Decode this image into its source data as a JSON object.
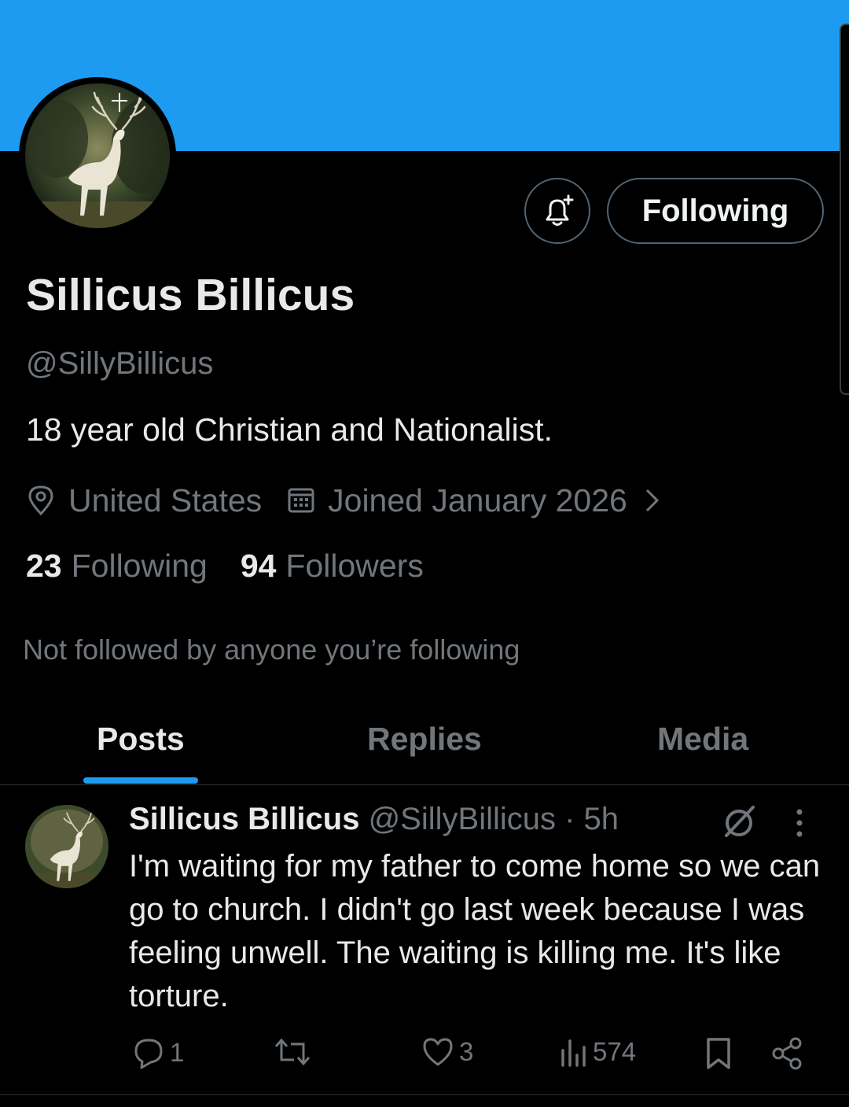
{
  "profile": {
    "name": "Sillicus Billicus",
    "handle": "@SillyBillicus",
    "bio": "18 year old Christian and Nationalist.",
    "location": "United States",
    "joined": "Joined January 2026",
    "following_count": "23",
    "following_label": "Following",
    "followers_count": "94",
    "followers_label": "Followers",
    "not_followed": "Not followed by anyone you’re following",
    "follow_button": "Following"
  },
  "tabs": [
    {
      "label": "Posts",
      "active": true
    },
    {
      "label": "Replies",
      "active": false
    },
    {
      "label": "Media",
      "active": false
    }
  ],
  "post": {
    "author": "Sillicus Billicus",
    "handle": "@SillyBillicus",
    "time": " · 5h",
    "text": "I'm waiting for my father to come home so we can go to church. I didn't go last week because I was feeling unwell. The waiting is killing me. It's like torture.",
    "replies": "1",
    "reposts": "",
    "likes": "3",
    "views": "574"
  },
  "colors": {
    "banner": "#1d9bf0",
    "accent": "#1d9bf0",
    "background": "#000000",
    "text": "#e7e9ea",
    "secondary": "#71767b"
  }
}
